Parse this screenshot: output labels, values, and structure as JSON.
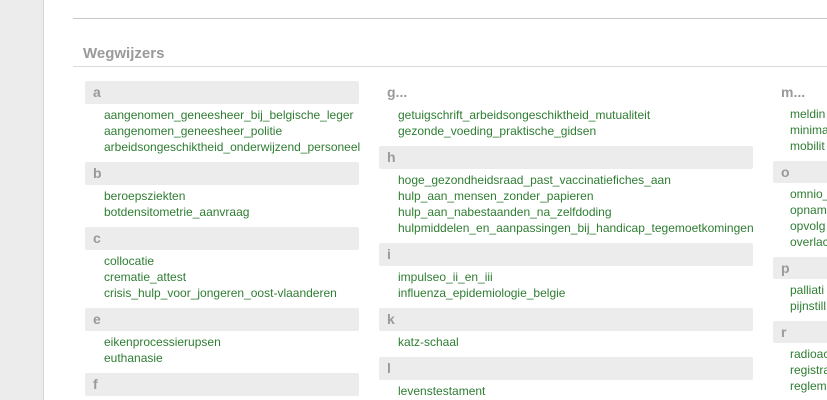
{
  "section_title": "Wegwijzers",
  "columns": [
    {
      "groups": [
        {
          "letter": "a",
          "links": [
            "aangenomen_geneesheer_bij_belgische_leger",
            "aangenomen_geneesheer_politie",
            "arbeidsongeschiktheid_onderwijzend_personeel"
          ]
        },
        {
          "letter": "b",
          "links": [
            "beroepsziekten",
            "botdensitometrie_aanvraag"
          ]
        },
        {
          "letter": "c",
          "links": [
            "collocatie",
            "crematie_attest",
            "crisis_hulp_voor_jongeren_oost-vlaanderen"
          ]
        },
        {
          "letter": "e",
          "links": [
            "eikenprocessierupsen",
            "euthanasie"
          ]
        },
        {
          "letter": "f",
          "links": []
        }
      ]
    },
    {
      "groups": [
        {
          "letter": "g...",
          "links": [
            "getuigschrift_arbeidsongeschiktheid_mutualiteit",
            "gezonde_voeding_praktische_gidsen"
          ]
        },
        {
          "letter": "h",
          "links": [
            "hoge_gezondheidsraad_past_vaccinatiefiches_aan",
            "hulp_aan_mensen_zonder_papieren",
            "hulp_aan_nabestaanden_na_zelfdoding",
            "hulpmiddelen_en_aanpassingen_bij_handicap_tegemoetkomingen"
          ]
        },
        {
          "letter": "i",
          "links": [
            "impulseo_ii_en_iii",
            "influenza_epidemiologie_belgie"
          ]
        },
        {
          "letter": "k",
          "links": [
            "katz-schaal"
          ]
        },
        {
          "letter": "l",
          "links": [
            "levenstestament"
          ]
        }
      ]
    },
    {
      "groups": [
        {
          "letter": "m...",
          "links": [
            "meldin",
            "minima",
            "mobilit"
          ]
        },
        {
          "letter": "o",
          "links": [
            "omnio_",
            "opnam",
            "opvolg",
            "overlac"
          ]
        },
        {
          "letter": "p",
          "links": [
            "palliati",
            "pijnstill"
          ]
        },
        {
          "letter": "r",
          "links": [
            "radioac",
            "registra",
            "reglem"
          ]
        }
      ]
    }
  ]
}
